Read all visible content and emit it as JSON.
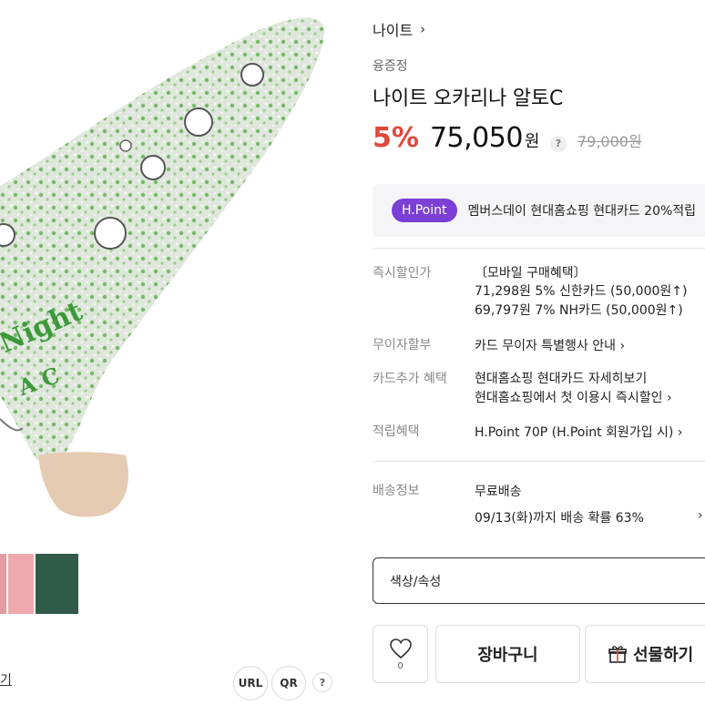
{
  "product": {
    "brand": "나이트",
    "seller": "융증정",
    "title": "나이트 오카리나 알토C",
    "discount": "5%",
    "price": "75,050",
    "price_unit": "원",
    "price_help": "?",
    "original_price": "79,000원",
    "image_text": "Night",
    "image_subtext": "A C"
  },
  "promo": {
    "badge": "H.Point",
    "text": "멤버스데이 현대홈쇼핑 현대카드 20%적립"
  },
  "benefits": {
    "instant_discount": {
      "label": "즉시할인가",
      "lines": [
        "〔모바일 구매혜택〕",
        "71,298원 5% 신한카드 (50,000원↑)",
        "69,797원 7% NH카드 (50,000원↑)"
      ]
    },
    "installment": {
      "label": "무이자할부",
      "text": "카드 무이자 특별행사 안내"
    },
    "card_extra": {
      "label": "카드추가 혜택",
      "lines": [
        "현대홈쇼핑 현대카드 자세히보기",
        "현대홈쇼핑에서 첫 이용시 즉시할인"
      ]
    },
    "points": {
      "label": "적립혜택",
      "text": "H.Point 70P (H.Point 회원가입 시)"
    }
  },
  "shipping": {
    "label": "배송정보",
    "line1": "무료배송",
    "line2": "09/13(화)까지 배송 확률 63%"
  },
  "option": {
    "label": "색상/속성"
  },
  "actions": {
    "like_count": "0",
    "cart": "장바구니",
    "gift": "선물하기"
  },
  "gallery": {
    "more_link": "기",
    "url_label": "URL",
    "qr_label": "QR",
    "help_label": "?"
  },
  "colors": {
    "accent_discount": "#e0483c",
    "hpoint_purple": "#7b3fd6",
    "ocarina_green": "#3d9a3a"
  }
}
